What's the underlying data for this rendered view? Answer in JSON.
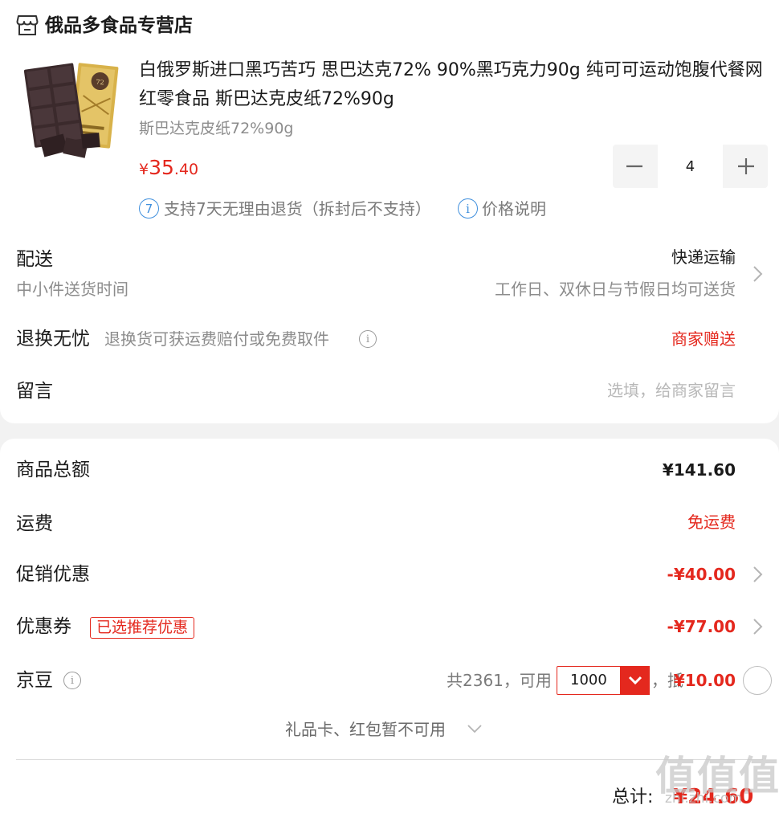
{
  "shop": {
    "name": "俄品多食品专营店",
    "icon": "store-icon"
  },
  "product": {
    "title": "白俄罗斯进口黑巧苦巧 思巴达克72% 90%黑巧克力90g 纯可可运动饱腹代餐网红零食品 斯巴达克皮纸72%90g",
    "spec": "斯巴达克皮纸72%90g",
    "price_symbol": "¥",
    "price_int": "35",
    "price_dec": ".40",
    "quantity": "4",
    "image": "chocolate-bar-image"
  },
  "services": {
    "return_badge": "7",
    "return_text": "支持7天无理由退货（拆封后不支持）",
    "price_info_badge": "i",
    "price_info_text": "价格说明"
  },
  "delivery": {
    "label": "配送",
    "sub": "中小件送货时间",
    "method": "快递运输",
    "schedule": "工作日、双休日与节假日均可送货"
  },
  "worry_free": {
    "label": "退换无忧",
    "desc": "退换货可获运费赔付或免费取件",
    "value": "商家赠送"
  },
  "message": {
    "label": "留言",
    "placeholder": "选填，给商家留言"
  },
  "summary": {
    "goods_total_label": "商品总额",
    "goods_total": "¥141.60",
    "shipping_label": "运费",
    "shipping": "免运费",
    "promo_label": "促销优惠",
    "promo": "-¥40.00",
    "coupon_label": "优惠券",
    "coupon_tag": "已选推荐优惠",
    "coupon": "-¥77.00",
    "beans_label": "京豆",
    "beans_available": "共2361，可用",
    "beans_select": "1000",
    "beans_deduct_prefix": "，抵",
    "beans_deduct": "¥10.00",
    "gift_card": "礼品卡、红包暂不可用",
    "total_label": "总计:",
    "total": "¥24.60"
  },
  "watermark": {
    "mark": "值值值",
    "site": "zhi.zhi.com"
  },
  "colors": {
    "accent": "#e4281e",
    "service_blue": "#3f8fdd",
    "text": "#1a1a1a",
    "muted": "#8c8c8c",
    "background": "#f2f2f2"
  }
}
